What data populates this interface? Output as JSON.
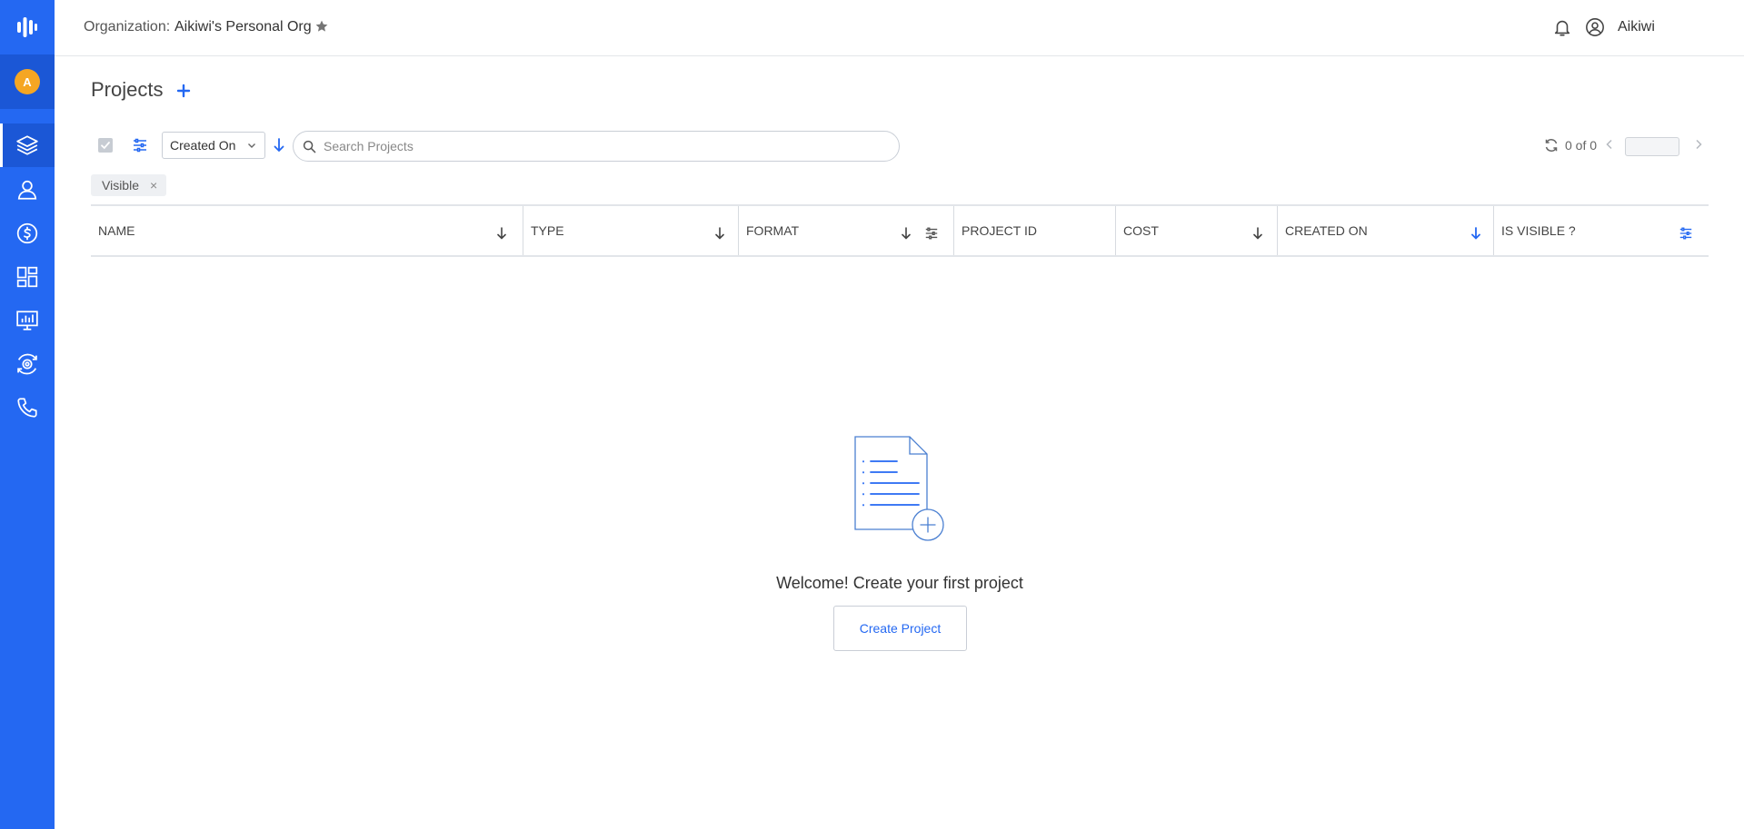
{
  "header": {
    "org_label": "Organization:",
    "org_name": "Aikiwi's Personal Org",
    "user_name": "Aikiwi"
  },
  "sidebar": {
    "avatar_initial": "A",
    "items": [
      {
        "icon": "layers-icon",
        "active": true
      },
      {
        "icon": "user-icon",
        "active": false
      },
      {
        "icon": "billing-icon",
        "active": false
      },
      {
        "icon": "dashboard-icon",
        "active": false
      },
      {
        "icon": "monitor-chart-icon",
        "active": false
      },
      {
        "icon": "settings-icon",
        "active": false
      },
      {
        "icon": "phone-icon",
        "active": false
      }
    ]
  },
  "page": {
    "title": "Projects"
  },
  "toolbar": {
    "sort_field": "Created On",
    "search_placeholder": "Search Projects",
    "pagination_count": "0 of 0"
  },
  "filters": {
    "chip_label": "Visible",
    "chip_remove": "×"
  },
  "table": {
    "columns": [
      "NAME",
      "TYPE",
      "FORMAT",
      "PROJECT ID",
      "COST",
      "CREATED ON",
      "IS VISIBLE ?"
    ]
  },
  "empty_state": {
    "message": "Welcome! Create your first project",
    "button_label": "Create Project"
  },
  "colors": {
    "brand": "#2468f2",
    "avatar": "#f5a623"
  }
}
